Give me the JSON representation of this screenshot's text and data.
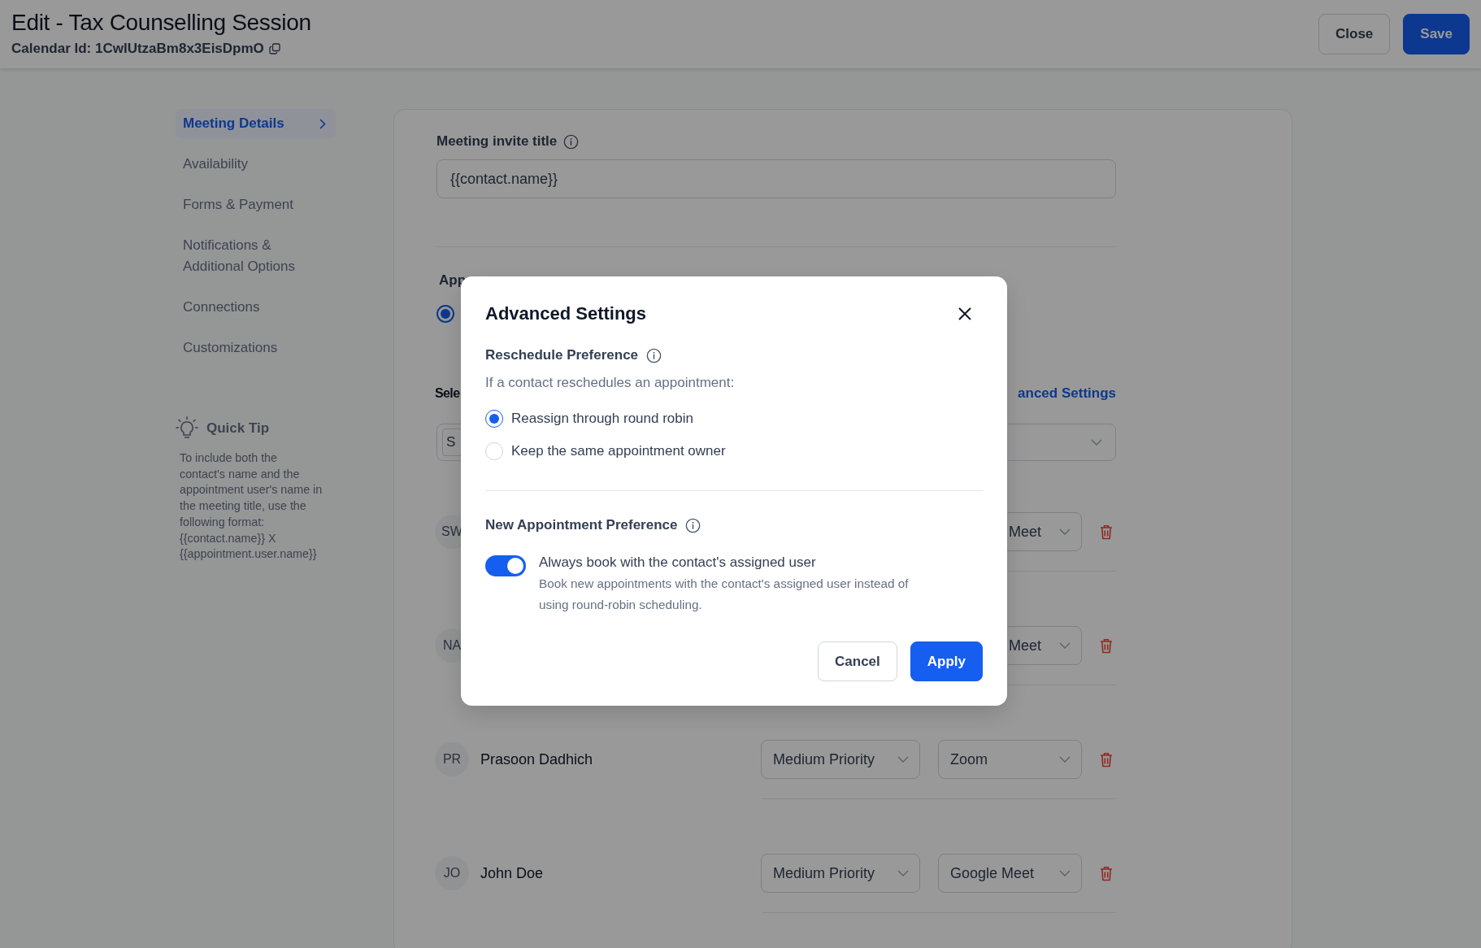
{
  "header": {
    "title": "Edit - Tax Counselling Session",
    "calendar_id": "Calendar Id: 1CwlUtzaBm8x3EisDpmO",
    "buttons": [
      {
        "label": "Close",
        "kind": "secondary"
      },
      {
        "label": "Save",
        "kind": "primary"
      }
    ]
  },
  "sidebar": {
    "items": [
      {
        "label": "Meeting Details",
        "selected": true
      },
      {
        "label": "Availability",
        "selected": false
      },
      {
        "label": "Forms & Payment",
        "selected": false
      },
      {
        "label": "Notifications & Additional Options",
        "selected": false
      },
      {
        "label": "Connections",
        "selected": false
      },
      {
        "label": "Customizations",
        "selected": false
      }
    ],
    "quick_tip": {
      "title": "Quick Tip",
      "text": "To include both the contact's name and the appointment user's name in the meeting title, use the following format: {{contact.name}} X {{appointment.user.name}}"
    }
  },
  "form": {
    "invite_title": {
      "label": "Meeting invite title",
      "value": "{{contact.name}}"
    },
    "distribution": {
      "label": "App",
      "selected": true
    },
    "select_label": "Sele",
    "advanced_link": "anced Settings",
    "select_value": "S",
    "members": [
      {
        "kind": "covered",
        "initials": "SW",
        "meeting": "Meet"
      },
      {
        "kind": "covered",
        "initials": "NA",
        "meeting": "Meet"
      },
      {
        "kind": "full",
        "initials": "PR",
        "name": "Prasoon Dadhich",
        "priority": "Medium Priority",
        "meeting": "Zoom"
      },
      {
        "kind": "full",
        "initials": "JO",
        "name": "John Doe",
        "priority": "Medium Priority",
        "meeting": "Google Meet"
      }
    ]
  },
  "modal": {
    "title": "Advanced Settings",
    "reschedule": {
      "label": "Reschedule Preference",
      "prompt": "If a contact reschedules an appointment:",
      "options": [
        {
          "label": "Reassign through round robin",
          "selected": true
        },
        {
          "label": "Keep the same appointment owner",
          "selected": false
        }
      ]
    },
    "new_appointment": {
      "label": "New Appointment Preference",
      "toggle": {
        "on": true,
        "label": "Always book with the contact's assigned user",
        "description": "Book new appointments with the contact's assigned user instead of using round-robin scheduling."
      }
    },
    "buttons": [
      {
        "label": "Cancel",
        "kind": "secondary"
      },
      {
        "label": "Apply",
        "kind": "primary"
      }
    ]
  }
}
